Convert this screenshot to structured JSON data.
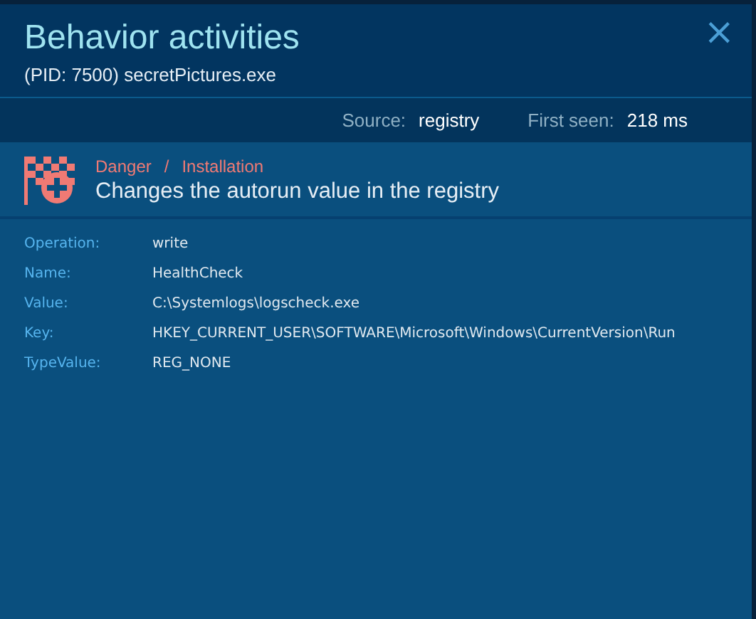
{
  "window": {
    "title": "Behavior activities",
    "subtitle": "(PID: 7500) secretPictures.exe",
    "close": "×"
  },
  "meta": [
    {
      "label": "Source:",
      "value": "registry"
    },
    {
      "label": "First seen:",
      "value": "218 ms"
    }
  ],
  "event": {
    "severity": "Danger",
    "separator": "/",
    "category": "Installation",
    "description": "Changes the autorun value in the registry"
  },
  "details": [
    {
      "label": "Operation:",
      "value": "write"
    },
    {
      "label": "Name:",
      "value": "HealthCheck"
    },
    {
      "label": "Value:",
      "value": "C:\\Systemlogs\\logscheck.exe"
    },
    {
      "label": "Key:",
      "value": "HKEY_CURRENT_USER\\SOFTWARE\\Microsoft\\Windows\\CurrentVersion\\Run"
    },
    {
      "label": "TypeValue:",
      "value": "REG_NONE"
    }
  ]
}
